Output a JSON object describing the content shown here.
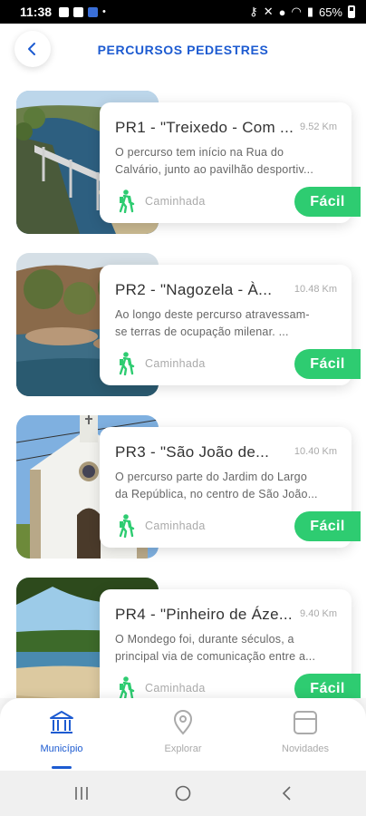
{
  "status_bar": {
    "time": "11:38",
    "battery": "65%",
    "icons": [
      "gallery-icon",
      "teams-icon",
      "app-icon",
      "dot-icon",
      "key-icon",
      "mute-icon",
      "location-icon",
      "wifi-icon",
      "signal-icon",
      "battery-icon"
    ]
  },
  "header": {
    "title": "PERCURSOS PEDESTRES",
    "back_icon": "chevron-left-icon"
  },
  "routes": [
    {
      "title": "PR1 - \"Treixedo - Com ...",
      "distance": "9.52 Km",
      "desc_line1": "O percurso tem início na Rua do",
      "desc_line2": "Calvário, junto ao pavilhão desportiv...",
      "type": "Caminhada",
      "difficulty": "Fácil"
    },
    {
      "title": "PR2 - \"Nagozela - À...",
      "distance": "10.48 Km",
      "desc_line1": "Ao longo deste percurso atravessam-",
      "desc_line2": "se terras de ocupação milenar. ...",
      "type": "Caminhada",
      "difficulty": "Fácil"
    },
    {
      "title": "PR3 - \"São João de...",
      "distance": "10.40 Km",
      "desc_line1": "O percurso parte do Jardim do Largo",
      "desc_line2": "da República, no centro de São João...",
      "type": "Caminhada",
      "difficulty": "Fácil"
    },
    {
      "title": "PR4 - \"Pinheiro de Áze...",
      "distance": "9.40 Km",
      "desc_line1": "O Mondego foi, durante séculos, a",
      "desc_line2": "principal via de comunicação entre a...",
      "type": "Caminhada",
      "difficulty": "Fácil"
    }
  ],
  "bottom_nav": {
    "items": [
      {
        "label": "Município",
        "icon": "institution-icon",
        "active": true
      },
      {
        "label": "Explorar",
        "icon": "location-pin-icon",
        "active": false
      },
      {
        "label": "Novidades",
        "icon": "news-icon",
        "active": false
      }
    ]
  },
  "colors": {
    "accent": "#1d5bd1",
    "difficulty_easy": "#2ecc71",
    "hike_icon": "#2ecc71"
  }
}
